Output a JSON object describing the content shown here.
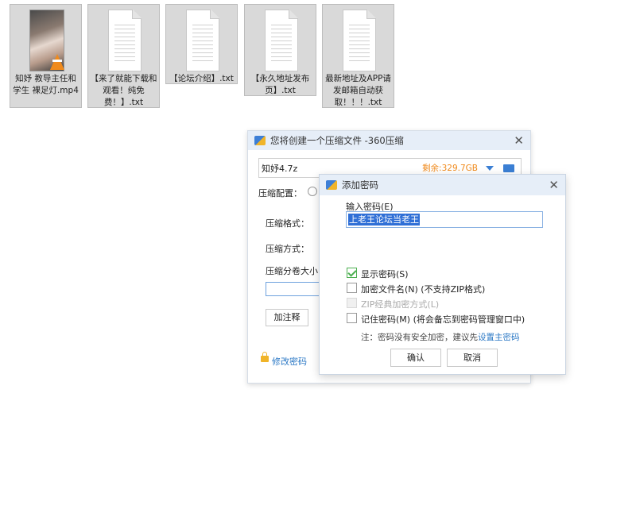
{
  "desktop": {
    "files": [
      {
        "name": "知妤 教导主任和学生 裸足灯.mp4",
        "type": "video"
      },
      {
        "name": "【来了就能下载和观看！纯免费！】.txt",
        "type": "text"
      },
      {
        "name": "【论坛介绍】.txt",
        "type": "text"
      },
      {
        "name": "【永久地址发布页】.txt",
        "type": "text"
      },
      {
        "name": "最新地址及APP请发邮箱自动获取！！！.txt",
        "type": "text"
      }
    ]
  },
  "main_window": {
    "title": "您将创建一个压缩文件 -360压缩",
    "close_symbol": "✕",
    "archive_name": "知妤4.7z",
    "free_space": "剩余:329.7GB",
    "label_config": "压缩配置：",
    "label_format": "压缩格式：",
    "label_method": "压缩方式：",
    "label_split": "压缩分卷大小：",
    "add_comment": "加注释",
    "change_password": "修改密码"
  },
  "password_dialog": {
    "title": "添加密码",
    "close_symbol": "✕",
    "input_label": "输入密码(E)",
    "password_value": "上老王论坛当老王",
    "options": [
      {
        "label": "显示密码(S)",
        "checked": true,
        "disabled": false
      },
      {
        "label": "加密文件名(N) (不支持ZIP格式)",
        "checked": false,
        "disabled": false
      },
      {
        "label": "ZIP经典加密方式(L)",
        "checked": false,
        "disabled": true
      },
      {
        "label": "记住密码(M) (将会备忘到密码管理窗口中)",
        "checked": false,
        "disabled": false
      }
    ],
    "note_prefix": "注：密码没有安全加密，建议先",
    "note_link": "设置主密码",
    "ok_label": "确认",
    "cancel_label": "取消"
  },
  "colors": {
    "accent": "#2b78c5",
    "free_space": "#f08a1c",
    "titlebar": "#e6eef8",
    "selection": "#2f6fd6"
  },
  "icons": [
    "video-thumbnail-icon",
    "text-file-icon",
    "app-icon",
    "close-icon",
    "dropdown-arrow-icon",
    "folder-icon",
    "lock-icon",
    "checkbox-icon"
  ]
}
